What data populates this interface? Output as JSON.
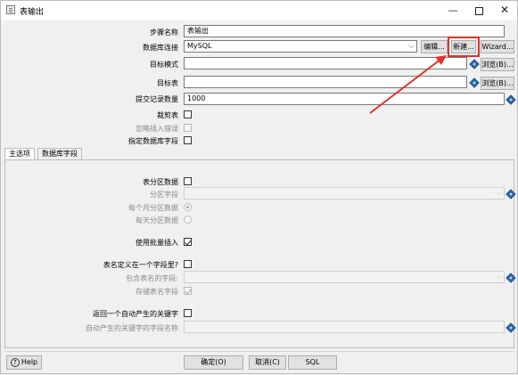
{
  "window": {
    "title": "表输出",
    "icon": "window-app-icon",
    "minimize": "—",
    "close": "✕"
  },
  "form": {
    "step_name_label": "步骤名称",
    "step_name_value": "表输出",
    "db_conn_label": "数据库连接",
    "db_conn_value": "MySQL",
    "edit_button": "编辑...",
    "new_button": "新建...",
    "wizard_button": "Wizard...",
    "schema_label": "目标模式",
    "schema_value": "",
    "browse_schema_button": "浏览(B)...",
    "table_label": "目标表",
    "table_value": "",
    "browse_table_button": "浏览(B)...",
    "commit_size_label": "提交记录数量",
    "commit_size_value": "1000",
    "truncate_label": "裁剪表",
    "ignore_errors_label": "忽略插入错误",
    "specify_fields_label": "指定数据库字段"
  },
  "tabs": [
    {
      "label": "主选项"
    },
    {
      "label": "数据库字段"
    }
  ],
  "main_options": {
    "partition_label": "表分区数据",
    "partition_field_label": "分区字段",
    "partition_field_value": "",
    "monthly_label": "每个月分区数据",
    "daily_label": "每天分区数据",
    "batch_insert_label": "使用批量插入",
    "table_name_in_field_label": "表名定义在一个字段里?",
    "field_with_table_name_label": "包含表名的字段:",
    "field_with_table_name_value": "",
    "store_table_name_label": "存储表名字段",
    "return_key_label": "返回一个自动产生的关键字",
    "key_field_name_label": "自动产生的关键字的字段名称",
    "key_field_name_value": ""
  },
  "footer": {
    "help_label": "Help",
    "ok_label": "确定(O)",
    "cancel_label": "取消(C)",
    "sql_label": "SQL"
  },
  "colors": {
    "annotation": "#e0322e",
    "variable_icon": "#2f6fb4"
  }
}
